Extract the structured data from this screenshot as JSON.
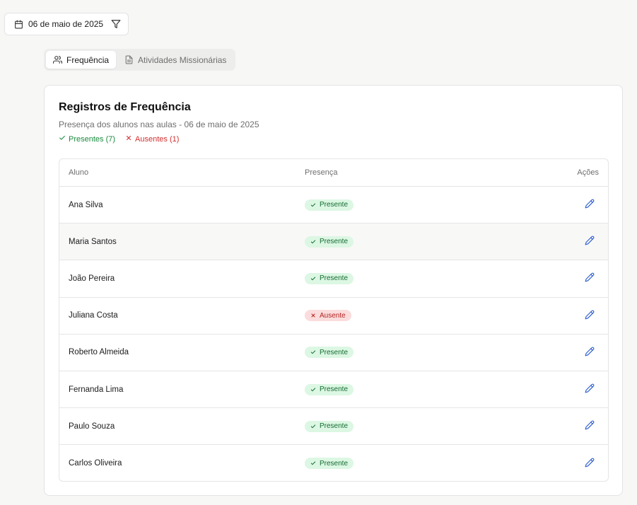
{
  "date_filter": {
    "label": "06 de maio de 2025"
  },
  "tabs": [
    {
      "label": "Frequência",
      "active": true
    },
    {
      "label": "Atividades Missionárias",
      "active": false
    }
  ],
  "card": {
    "title": "Registros de Frequência",
    "subtitle": "Presença dos alunos nas aulas - 06 de maio de 2025",
    "summary_present": "Presentes (7)",
    "summary_absent": "Ausentes (1)"
  },
  "table": {
    "headers": {
      "student": "Aluno",
      "attendance": "Presença",
      "actions": "Ações"
    },
    "rows": [
      {
        "name": "Ana Silva",
        "status": "Presente"
      },
      {
        "name": "Maria Santos",
        "status": "Presente"
      },
      {
        "name": "João Pereira",
        "status": "Presente"
      },
      {
        "name": "Juliana Costa",
        "status": "Ausente"
      },
      {
        "name": "Roberto Almeida",
        "status": "Presente"
      },
      {
        "name": "Fernanda Lima",
        "status": "Presente"
      },
      {
        "name": "Paulo Souza",
        "status": "Presente"
      },
      {
        "name": "Carlos Oliveira",
        "status": "Presente"
      }
    ]
  },
  "colors": {
    "present_text": "#1a8a3e",
    "absent_text": "#d32f2f",
    "edit_icon": "#2f5fd0"
  },
  "icons": {
    "date": "calendar-icon",
    "filter": "filter-icon",
    "tab_frequency": "users-icon",
    "tab_activities": "document-icon",
    "present": "check-icon",
    "absent": "x-icon",
    "edit": "pencil-icon"
  }
}
